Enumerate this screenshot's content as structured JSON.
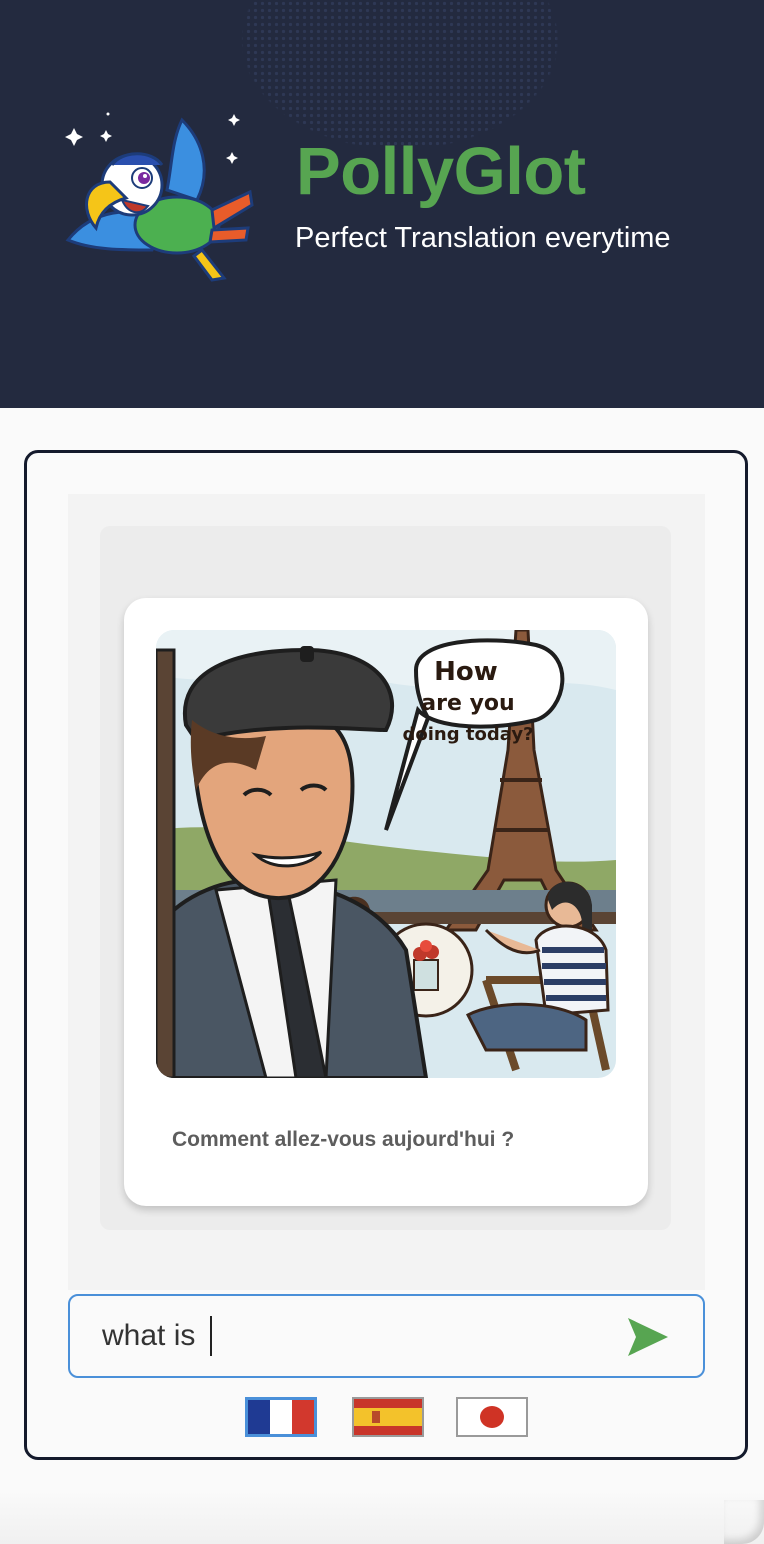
{
  "header": {
    "title": "PollyGlot",
    "subtitle": "Perfect Translation everytime",
    "logo_icon": "parrot-logo-icon"
  },
  "chat": {
    "speech_bubble": [
      "How",
      "are you",
      "doing today?"
    ],
    "translation": "Comment allez-vous aujourd'hui ?"
  },
  "input": {
    "value": "what is ",
    "send_icon": "send-arrow-icon"
  },
  "languages": [
    {
      "code": "fr",
      "name": "French",
      "selected": true
    },
    {
      "code": "es",
      "name": "Spanish",
      "selected": false
    },
    {
      "code": "jp",
      "name": "Japanese",
      "selected": false
    }
  ],
  "colors": {
    "header_bg": "#232a3f",
    "brand_green": "#57a551",
    "accent_blue": "#4a90d9",
    "panel_border": "#141a2c"
  }
}
